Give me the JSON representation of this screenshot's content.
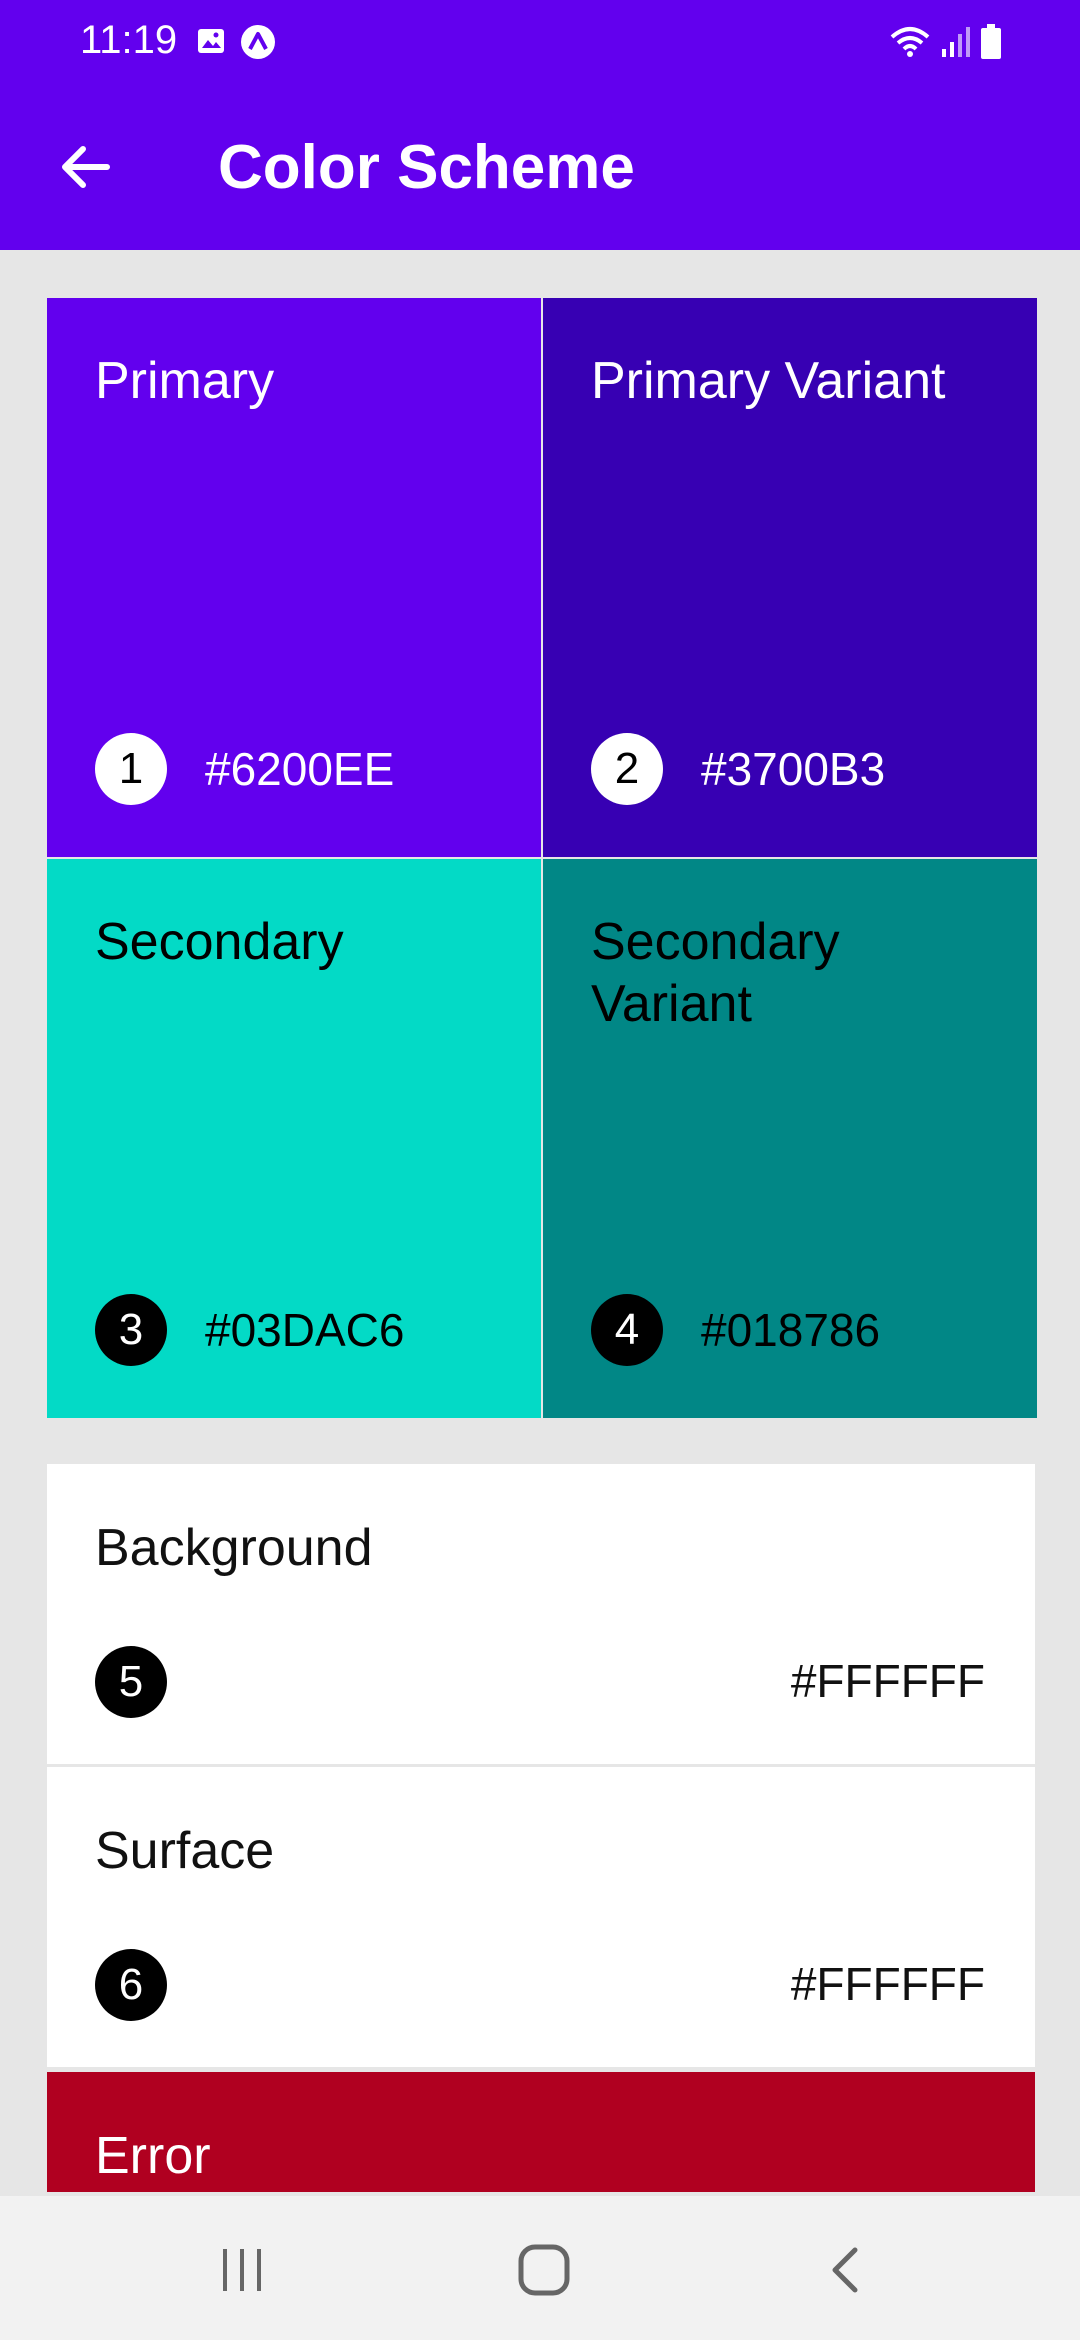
{
  "status_bar": {
    "time": "11:19",
    "icons": [
      "gallery-icon",
      "app-notification-icon",
      "wifi-icon",
      "signal-icon",
      "battery-icon"
    ]
  },
  "app_bar": {
    "title": "Color Scheme",
    "back_icon": "arrow-back-icon",
    "background": "#6200EE"
  },
  "color_tiles": [
    {
      "name": "Primary",
      "number": "1",
      "hex": "#6200EE",
      "bg": "#6200EE",
      "text_color": "#FFFFFF",
      "badge_bg": "#FFFFFF",
      "badge_fg": "#000000"
    },
    {
      "name": "Primary Variant",
      "number": "2",
      "hex": "#3700B3",
      "bg": "#3700B3",
      "text_color": "#FFFFFF",
      "badge_bg": "#FFFFFF",
      "badge_fg": "#000000"
    },
    {
      "name": "Secondary",
      "number": "3",
      "hex": "#03DAC6",
      "bg": "#03DAC6",
      "text_color": "#000000",
      "badge_bg": "#000000",
      "badge_fg": "#FFFFFF"
    },
    {
      "name": "Secondary Variant",
      "number": "4",
      "hex": "#018786",
      "bg": "#018786",
      "text_color": "#000000",
      "badge_bg": "#000000",
      "badge_fg": "#FFFFFF"
    }
  ],
  "color_rows": [
    {
      "name": "Background",
      "number": "5",
      "hex": "#FFFFFF"
    },
    {
      "name": "Surface",
      "number": "6",
      "hex": "#FFFFFF"
    }
  ],
  "error_row": {
    "name": "Error",
    "bg": "#B00020"
  },
  "nav_bar": {
    "buttons": [
      "recent-apps-icon",
      "home-icon",
      "back-icon"
    ]
  }
}
